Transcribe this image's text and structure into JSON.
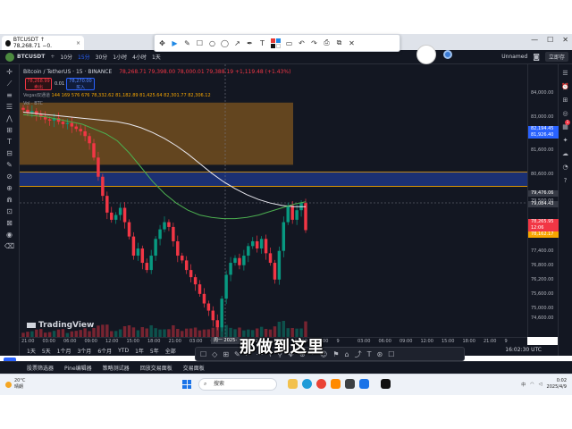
{
  "browser": {
    "tab_title": "BTCUSDT ↑ 78,268.71 −0.",
    "tab_close": "×",
    "controls": [
      "—",
      "☐",
      "✕"
    ]
  },
  "annotation_toolbar": {
    "tools": [
      "✥",
      "▶",
      "✎",
      "☐",
      "○",
      "◯",
      "↗",
      "✒",
      "T",
      "▭",
      "↶",
      "↷",
      "⎙",
      "⧉",
      "✕"
    ],
    "colors": [
      "#e53935",
      "#1e88e5",
      "#111111",
      "#ffffff"
    ]
  },
  "tv_top": {
    "symbol": "BTCUSDT",
    "add": "+",
    "timeframes": [
      "10分",
      "15分",
      "30分",
      "1小时",
      "4小时",
      "1天"
    ],
    "active_timeframe": 1,
    "layout_name": "Unnamed",
    "save_label": "立即存"
  },
  "legend": {
    "symbol": "Bitcoin / TetherUS · 15 · BINANCE",
    "ohlc": "78,268.71  79,398.00  78,000.01  79,388.19  +1,119.48 (+1.43%)",
    "sell_price": "78,268.99",
    "sell_label": "卖出",
    "buy_price": "78,270.00",
    "buy_label": "买入",
    "spread": "0.01",
    "indicator_name": "Vegas双通道",
    "indicator_values": "144  169  576  676  78,332.62  81,182.89  81,425.64  82,301.77  82,306.12",
    "indicator2": "Vol · BTC"
  },
  "chart_data": {
    "type": "candlestick",
    "symbol": "BTCUSDT",
    "interval": "15",
    "y_range": [
      73800,
      85200
    ],
    "x_range": [
      0,
      100
    ],
    "y_axis_ticks": [
      84000,
      83000,
      81600,
      80600,
      79500,
      78500,
      77400,
      76800,
      76200,
      75600,
      75000,
      74600
    ],
    "x_axis_labels": [
      "21:00",
      "03:00",
      "06:00",
      "09:00",
      "12:00",
      "15:00",
      "18:00",
      "21:00",
      "2025-04-07",
      "03:00",
      "06:00",
      "09:00",
      "12:00",
      "15:00",
      "18:00",
      "21:00",
      "9",
      "03:00",
      "06:00",
      "09:00",
      "12:00",
      "15:00",
      "18:00",
      "21:00",
      "9"
    ],
    "x_axis_highlight": "周一 2025-04-07",
    "price_tags": [
      {
        "value": "82,194.45",
        "color": "#2962ff"
      },
      {
        "value": "81,926.40",
        "color": "#2962ff"
      },
      {
        "value": "79,476.06",
        "color": "#363a45"
      },
      {
        "value": "79,084.43",
        "color": "#363a45"
      },
      {
        "value": "78,265.95",
        "color": "#f23645"
      },
      {
        "value": "12:06",
        "color": "#f23645"
      },
      {
        "value": "78,162.17",
        "color": "#f7a600"
      }
    ],
    "orange_zone": [
      81000,
      83600
    ],
    "blue_zone": [
      80100,
      80700
    ],
    "close_series": [
      83300,
      83200,
      83250,
      83100,
      83000,
      82900,
      82850,
      82950,
      82800,
      82700,
      82750,
      82600,
      82500,
      82400,
      82200,
      81900,
      81300,
      80500,
      79700,
      79000,
      78700,
      78900,
      79200,
      78600,
      78000,
      77200,
      77500,
      76900,
      76600,
      77200,
      77900,
      78300,
      78600,
      78400,
      77800,
      77200,
      77000,
      76600,
      76300,
      76000,
      75600,
      75200,
      74900,
      74500,
      74200,
      75400,
      76400,
      76900,
      77100,
      76800,
      77200,
      77600,
      77800,
      77500,
      77900,
      77300,
      76900,
      76200,
      77400,
      78600,
      79300,
      78700,
      79100,
      79400,
      78268
    ],
    "candle_range": [
      0,
      64
    ],
    "slow_ema": [
      83200,
      83150,
      83100,
      83050,
      83000,
      82950,
      82900,
      82850,
      82800,
      82700,
      82550,
      82350,
      82100,
      81800,
      81450,
      81050,
      80650,
      80300,
      80000,
      79750,
      79550,
      79400,
      79300,
      79250,
      79250
    ],
    "fast_ema": [
      83100,
      83050,
      83000,
      82900,
      82800,
      82700,
      82500,
      82300,
      82000,
      81500,
      80900,
      80300,
      79800,
      79400,
      79100,
      78900,
      78800,
      78750,
      78750,
      78800,
      78900,
      79050,
      79200,
      79350,
      79450
    ]
  },
  "time_axis": {
    "labels": [
      "21:00",
      "03:00",
      "06:00",
      "09:00",
      "12:00",
      "15:00",
      "18:00",
      "21:00",
      "03:00",
      "06:00",
      "09:00",
      "12:00",
      "15:00",
      "18:00",
      "21:00",
      "9",
      "03:00",
      "06:00",
      "09:00",
      "12:00",
      "15:00",
      "18:00",
      "21:00",
      "9"
    ],
    "highlight": "周一 2025-04-07"
  },
  "range_bar": {
    "ranges": [
      "1天",
      "5天",
      "1个月",
      "3个月",
      "6个月",
      "YTD",
      "1年",
      "5年",
      "全部"
    ],
    "clock": "16:02:30 UTC"
  },
  "drawing_toolbar": [
    "☐",
    "◇",
    "⊞",
    "✎",
    "⟋",
    "⋯",
    "⌇",
    "⚲",
    "✥",
    "⊕",
    "⌖",
    "☺",
    "⚑",
    "⌂",
    "⤴",
    "T",
    "⊛",
    "☐"
  ],
  "panel_tabs": [
    "股票筛选器",
    "Pine编辑器",
    "策略测试器",
    "回放交易面板",
    "交易面板"
  ],
  "subtitle": "那做到这里",
  "watermark": "TradingView",
  "taskbar": {
    "weather_temp": "20°C",
    "weather_desc": "晴朗",
    "search_placeholder": "搜索",
    "time": "0:02",
    "date": "2025/4/9",
    "tray_text": "中"
  }
}
